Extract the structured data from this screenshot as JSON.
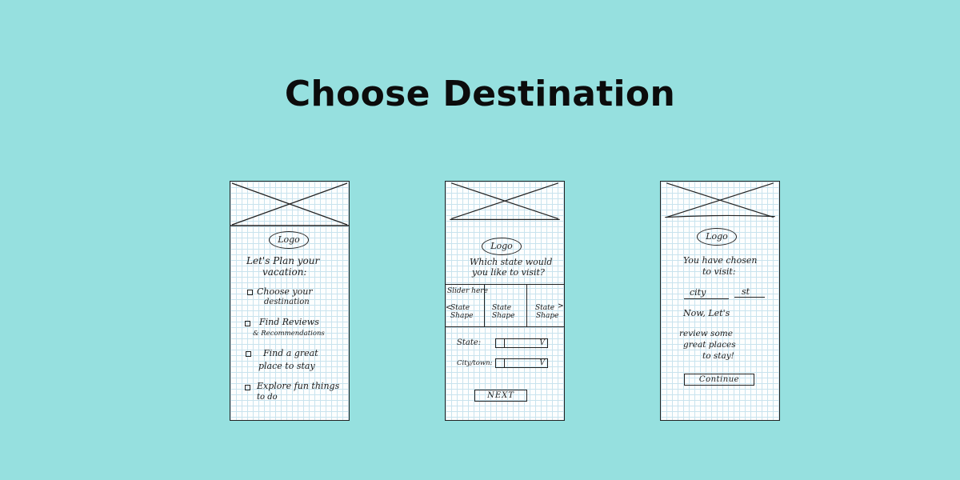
{
  "page": {
    "title": "Choose Destination",
    "background": "#96e0df"
  },
  "screen1": {
    "logo": "Logo",
    "heading_line1": "Let's Plan your",
    "heading_line2": "vacation:",
    "items": [
      {
        "line1": "Choose your",
        "line2": "destination"
      },
      {
        "line1": "Find Reviews",
        "line2": "& Recommendations"
      },
      {
        "line1": "Find a great",
        "line2": "place to stay"
      },
      {
        "line1": "Explore fun things",
        "line2": "to do"
      }
    ]
  },
  "screen2": {
    "logo": "Logo",
    "question_line1": "Which state would",
    "question_line2": "you like to visit?",
    "slider_label": "Slider here",
    "slides": [
      {
        "line1": "State",
        "line2": "Shape",
        "arrow": "<"
      },
      {
        "line1": "State",
        "line2": "Shape"
      },
      {
        "line1": "State",
        "line2": "Shape",
        "arrow": ">"
      }
    ],
    "state_label": "State:",
    "state_chevron": "V",
    "city_label": "City/town:",
    "city_chevron": "V",
    "next_button": "NEXT"
  },
  "screen3": {
    "logo": "Logo",
    "line1": "You have chosen",
    "line2": "to visit:",
    "city": "city",
    "state": "st",
    "line3": "Now, Let's",
    "line4": "review some",
    "line5": "great places",
    "line6": "to stay!",
    "continue_button": "Continue"
  }
}
